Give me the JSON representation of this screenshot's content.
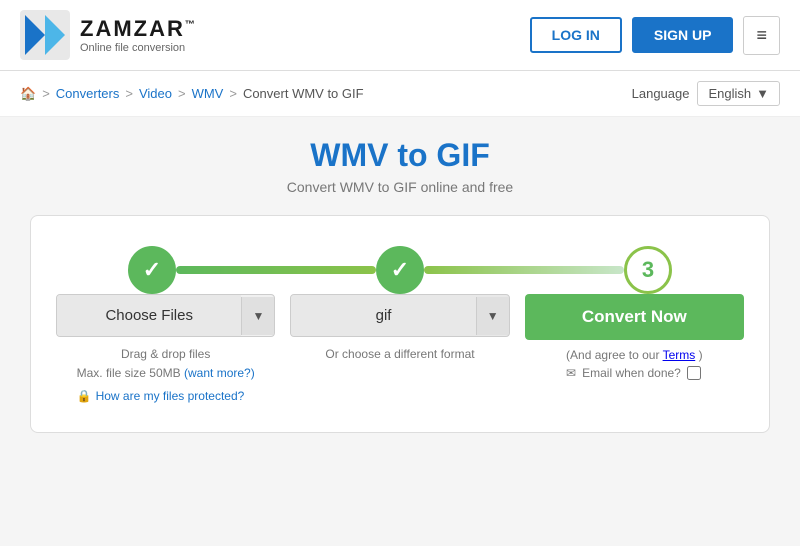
{
  "header": {
    "logo_name": "ZAMZAR",
    "logo_tm": "™",
    "logo_subtitle": "Online file conversion",
    "login_label": "LOG IN",
    "signup_label": "SIGN UP",
    "menu_icon": "≡"
  },
  "breadcrumb": {
    "home_icon": "🏠",
    "items": [
      "Converters",
      "Video",
      "WMV",
      "Convert WMV to GIF"
    ],
    "separators": [
      ">",
      ">",
      ">",
      ">"
    ]
  },
  "language": {
    "label": "Language",
    "selected": "English",
    "dropdown_arrow": "▼"
  },
  "page": {
    "title": "WMV to GIF",
    "subtitle": "Convert WMV to GIF online and free"
  },
  "steps": {
    "step1": {
      "label": "✓",
      "state": "completed"
    },
    "step2": {
      "label": "✓",
      "state": "completed"
    },
    "step3": {
      "label": "3",
      "state": "active"
    }
  },
  "actions": {
    "choose_files": "Choose Files",
    "choose_files_arrow": "▼",
    "format": "gif",
    "format_arrow": "▼",
    "convert_now": "Convert Now",
    "drag_drop": "Drag & drop files",
    "max_size": "Max. file size 50MB",
    "want_more": "(want more?)",
    "protection_link": "How are my files protected?",
    "format_hint": "Or choose a different format",
    "terms_prefix": "(And agree to our",
    "terms_link": "Terms",
    "terms_suffix": ")",
    "email_label": "Email when done?",
    "lock_icon": "🔒",
    "envelope_icon": "✉"
  }
}
